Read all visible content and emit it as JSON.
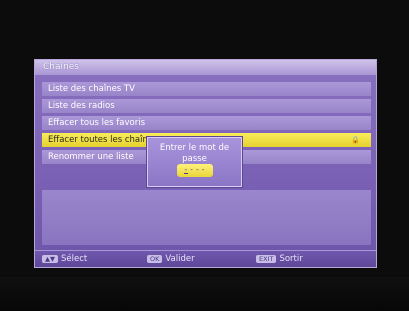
{
  "window": {
    "title": "Chaînes"
  },
  "menu": {
    "items": [
      {
        "label": "Liste des chaînes TV",
        "selected": false
      },
      {
        "label": "Liste des radios",
        "selected": false
      },
      {
        "label": "Effacer tous les favoris",
        "selected": false
      },
      {
        "label": "Effacer toutes les chaînes",
        "selected": true,
        "icon": "lock-icon"
      },
      {
        "label": "Renommer une liste",
        "selected": false
      }
    ]
  },
  "dialog": {
    "title": "Entrer le mot de passe",
    "password_value": "----"
  },
  "footer": {
    "select_key": "▲▼",
    "select_label": "Sélect",
    "ok_key": "OK",
    "ok_label": "Valider",
    "exit_key": "EXIT",
    "exit_label": "Sortir"
  },
  "colors": {
    "panel": "#7a60b4",
    "item": "#a08cd0",
    "highlight": "#f0e040",
    "title_bar": "#c0b0e0"
  }
}
